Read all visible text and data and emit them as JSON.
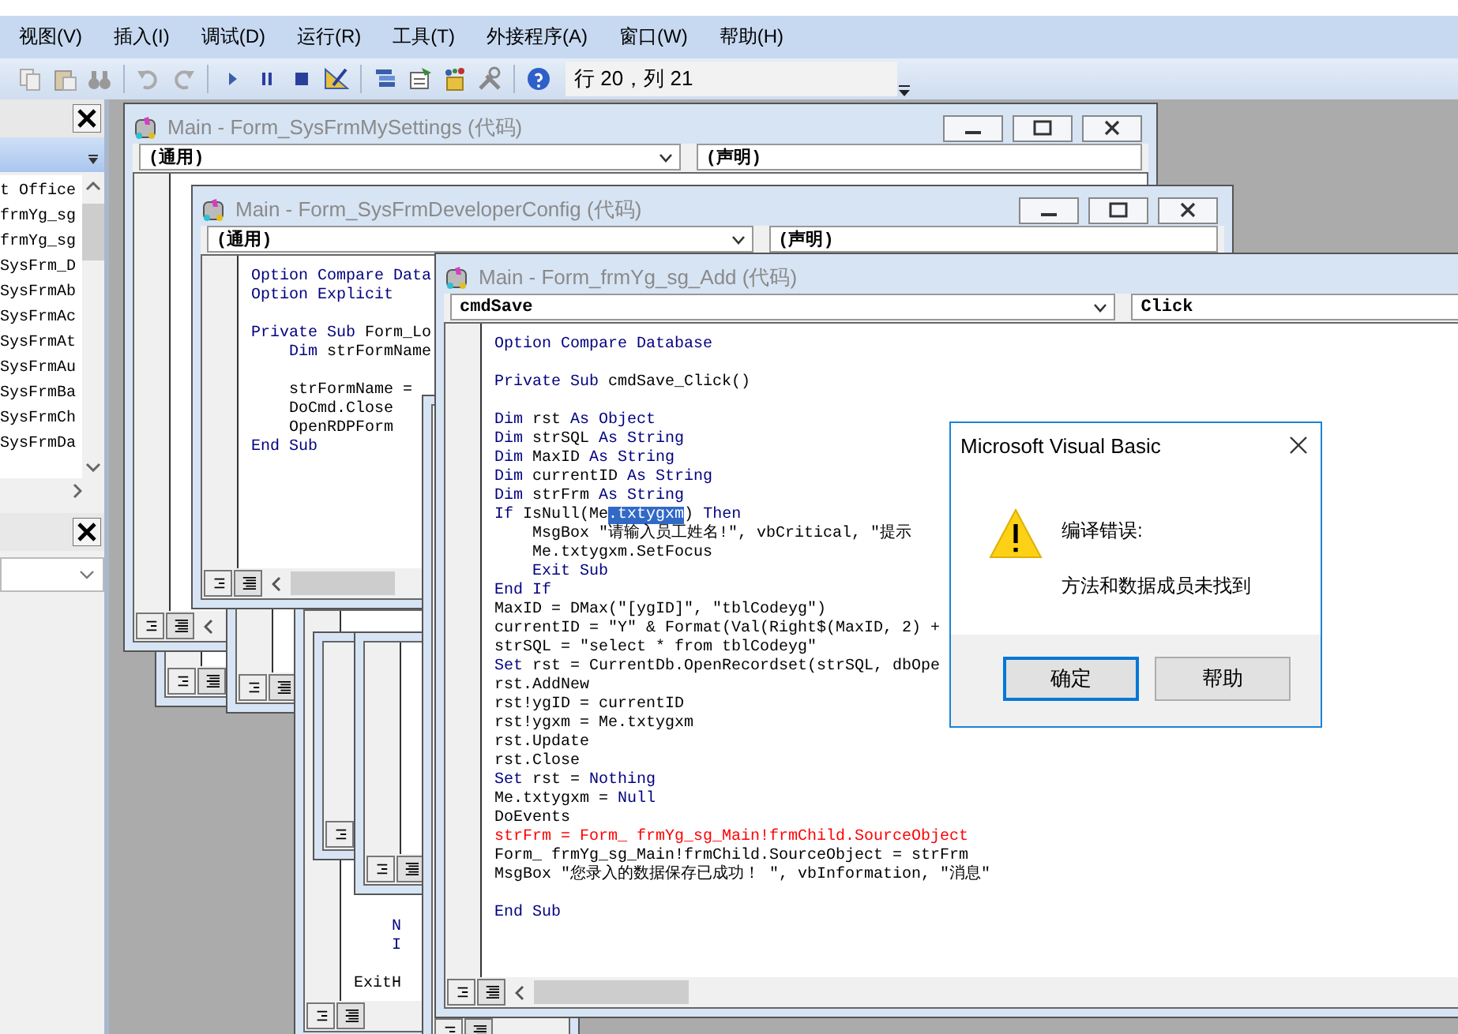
{
  "menu": [
    "视图(V)",
    "插入(I)",
    "调试(D)",
    "运行(R)",
    "工具(T)",
    "外接程序(A)",
    "窗口(W)",
    "帮助(H)"
  ],
  "toolbar": {
    "position": "行 20，列 21"
  },
  "project_panel": {
    "items": [
      "t Office",
      "frmYg_sg",
      "frmYg_sg",
      "SysFrm_D",
      "SysFrmAb",
      "SysFrmAc",
      "SysFrmAt",
      "SysFrmAu",
      "SysFrmBa",
      "SysFrmCh",
      "SysFrmDa"
    ]
  },
  "code_windows": [
    {
      "title": "Main - Form_SysFrmMySettings (代码)",
      "object": "(通用)",
      "procedure": "(声明)"
    },
    {
      "lines": [
        {
          "kind": "code",
          "segments": [
            {
              "kind": "keyword",
              "text": "    N"
            }
          ]
        },
        {
          "kind": "code",
          "segments": [
            {
              "kind": "keyword",
              "text": "    I"
            }
          ]
        },
        {
          "kind": "blank"
        },
        {
          "kind": "code",
          "segments": [
            {
              "kind": "plain",
              "text": "ExitH"
            }
          ]
        }
      ]
    },
    {
      "title": "Main - Form_SysFrmDeveloperConfig (代码)",
      "object": "(通用)",
      "procedure": "(声明)",
      "lines": [
        {
          "kind": "code",
          "segments": [
            {
              "kind": "keyword",
              "text": "Option Compare Data"
            }
          ]
        },
        {
          "kind": "code",
          "segments": [
            {
              "kind": "keyword",
              "text": "Option Explicit"
            }
          ]
        },
        {
          "kind": "blank"
        },
        {
          "kind": "code",
          "segments": [
            {
              "kind": "keyword",
              "text": "Private Sub"
            },
            {
              "kind": "plain",
              "text": " Form_Lo"
            }
          ]
        },
        {
          "kind": "code",
          "segments": [
            {
              "kind": "keyword",
              "text": "    Dim"
            },
            {
              "kind": "plain",
              "text": " strFormName"
            }
          ]
        },
        {
          "kind": "blank"
        },
        {
          "kind": "code",
          "segments": [
            {
              "kind": "plain",
              "text": "    strFormName ="
            }
          ]
        },
        {
          "kind": "code",
          "segments": [
            {
              "kind": "plain",
              "text": "    DoCmd.Close"
            }
          ]
        },
        {
          "kind": "code",
          "segments": [
            {
              "kind": "plain",
              "text": "    OpenRDPForm"
            }
          ]
        },
        {
          "kind": "code",
          "segments": [
            {
              "kind": "keyword",
              "text": "End Sub"
            }
          ]
        }
      ]
    },
    {
      "title": "Main - Form_frmYg_sg_Add (代码)",
      "object": "cmdSave",
      "procedure": "Click",
      "lines": [
        {
          "kind": "code",
          "segments": [
            {
              "kind": "keyword",
              "text": "Option Compare Database"
            }
          ]
        },
        {
          "kind": "blank"
        },
        {
          "kind": "code",
          "segments": [
            {
              "kind": "keyword",
              "text": "Private Sub"
            },
            {
              "kind": "plain",
              "text": " cmdSave_Click()"
            }
          ]
        },
        {
          "kind": "blank"
        },
        {
          "kind": "code",
          "segments": [
            {
              "kind": "keyword",
              "text": "Dim"
            },
            {
              "kind": "plain",
              "text": " rst "
            },
            {
              "kind": "keyword",
              "text": "As Object"
            }
          ]
        },
        {
          "kind": "code",
          "segments": [
            {
              "kind": "keyword",
              "text": "Dim"
            },
            {
              "kind": "plain",
              "text": " strSQL "
            },
            {
              "kind": "keyword",
              "text": "As String"
            }
          ]
        },
        {
          "kind": "code",
          "segments": [
            {
              "kind": "keyword",
              "text": "Dim"
            },
            {
              "kind": "plain",
              "text": " MaxID "
            },
            {
              "kind": "keyword",
              "text": "As String"
            }
          ]
        },
        {
          "kind": "code",
          "segments": [
            {
              "kind": "keyword",
              "text": "Dim"
            },
            {
              "kind": "plain",
              "text": " currentID "
            },
            {
              "kind": "keyword",
              "text": "As String"
            }
          ]
        },
        {
          "kind": "code",
          "segments": [
            {
              "kind": "keyword",
              "text": "Dim"
            },
            {
              "kind": "plain",
              "text": " strFrm "
            },
            {
              "kind": "keyword",
              "text": "As String"
            }
          ]
        },
        {
          "kind": "code",
          "segments": [
            {
              "kind": "keyword",
              "text": "If"
            },
            {
              "kind": "plain",
              "text": " IsNull(Me"
            },
            {
              "kind": "selected",
              "text": ".txtygxm"
            },
            {
              "kind": "plain",
              "text": ") "
            },
            {
              "kind": "keyword",
              "text": "Then"
            }
          ]
        },
        {
          "kind": "code",
          "segments": [
            {
              "kind": "plain",
              "text": "    MsgBox \"请输入员工姓名!\", vbCritical, \"提示"
            }
          ]
        },
        {
          "kind": "code",
          "segments": [
            {
              "kind": "plain",
              "text": "    Me.txtygxm.SetFocus"
            }
          ]
        },
        {
          "kind": "code",
          "segments": [
            {
              "kind": "keyword",
              "text": "    Exit Sub"
            }
          ]
        },
        {
          "kind": "code",
          "segments": [
            {
              "kind": "keyword",
              "text": "End If"
            }
          ]
        },
        {
          "kind": "code",
          "segments": [
            {
              "kind": "plain",
              "text": "MaxID = DMax(\"[ygID]\", \"tblCodeyg\")"
            }
          ]
        },
        {
          "kind": "code",
          "segments": [
            {
              "kind": "plain",
              "text": "currentID = \"Y\" & Format(Val(Right$(MaxID, 2) +"
            }
          ]
        },
        {
          "kind": "code",
          "segments": [
            {
              "kind": "plain",
              "text": "strSQL = \"select * from tblCodeyg\""
            }
          ]
        },
        {
          "kind": "code",
          "segments": [
            {
              "kind": "keyword",
              "text": "Set"
            },
            {
              "kind": "plain",
              "text": " rst = CurrentDb.OpenRecordset(strSQL, dbOpe"
            }
          ]
        },
        {
          "kind": "code",
          "segments": [
            {
              "kind": "plain",
              "text": "rst.AddNew"
            }
          ]
        },
        {
          "kind": "code",
          "segments": [
            {
              "kind": "plain",
              "text": "rst!ygID = currentID"
            }
          ]
        },
        {
          "kind": "code",
          "segments": [
            {
              "kind": "plain",
              "text": "rst!ygxm = Me.txtygxm"
            }
          ]
        },
        {
          "kind": "code",
          "segments": [
            {
              "kind": "plain",
              "text": "rst.Update"
            }
          ]
        },
        {
          "kind": "code",
          "segments": [
            {
              "kind": "plain",
              "text": "rst.Close"
            }
          ]
        },
        {
          "kind": "code",
          "segments": [
            {
              "kind": "keyword",
              "text": "Set"
            },
            {
              "kind": "plain",
              "text": " rst = "
            },
            {
              "kind": "keyword",
              "text": "Nothing"
            }
          ]
        },
        {
          "kind": "code",
          "segments": [
            {
              "kind": "plain",
              "text": "Me.txtygxm = "
            },
            {
              "kind": "keyword",
              "text": "Null"
            }
          ]
        },
        {
          "kind": "code",
          "segments": [
            {
              "kind": "plain",
              "text": "DoEvents"
            }
          ]
        },
        {
          "kind": "code",
          "segments": [
            {
              "kind": "error",
              "text": "strFrm = Form_ frmYg_sg_Main!frmChild.SourceObject"
            }
          ]
        },
        {
          "kind": "code",
          "segments": [
            {
              "kind": "plain",
              "text": "Form_ frmYg_sg_Main!frmChild.SourceObject = strFrm"
            }
          ]
        },
        {
          "kind": "code",
          "segments": [
            {
              "kind": "plain",
              "text": "MsgBox \"您录入的数据保存已成功！ \", vbInformation, \"消息\""
            }
          ]
        },
        {
          "kind": "blank"
        },
        {
          "kind": "code",
          "segments": [
            {
              "kind": "keyword",
              "text": "End Sub"
            }
          ]
        }
      ]
    }
  ],
  "dialog": {
    "title": "Microsoft Visual Basic",
    "heading": "编译错误:",
    "message": "方法和数据成员未找到",
    "buttons": [
      {
        "label": "确定",
        "default": true
      },
      {
        "label": "帮助",
        "default": false
      }
    ]
  }
}
